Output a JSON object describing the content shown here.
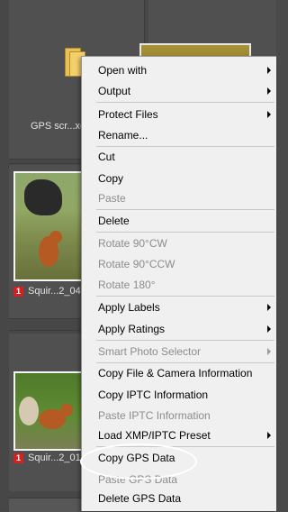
{
  "grid": {
    "folder_label": "GPS scr...xe",
    "photo1_label": "Squir...2_04",
    "photo2_label": "Squir...2_01",
    "rating_badge": "1",
    "badge_color": "#d62020"
  },
  "context_menu": {
    "items": [
      {
        "label": "Open with",
        "disabled": false,
        "submenu": true
      },
      {
        "label": "Output",
        "disabled": false,
        "submenu": true
      },
      {
        "label": "Protect Files",
        "disabled": false,
        "submenu": true
      },
      {
        "label": "Rename...",
        "disabled": false,
        "submenu": false
      },
      {
        "label": "Cut",
        "disabled": false,
        "submenu": false
      },
      {
        "label": "Copy",
        "disabled": false,
        "submenu": false
      },
      {
        "label": "Paste",
        "disabled": true,
        "submenu": false
      },
      {
        "label": "Delete",
        "disabled": false,
        "submenu": false
      },
      {
        "label": "Rotate 90°CW",
        "disabled": true,
        "submenu": false
      },
      {
        "label": "Rotate 90°CCW",
        "disabled": true,
        "submenu": false
      },
      {
        "label": "Rotate 180°",
        "disabled": true,
        "submenu": false
      },
      {
        "label": "Apply Labels",
        "disabled": false,
        "submenu": true
      },
      {
        "label": "Apply Ratings",
        "disabled": false,
        "submenu": true
      },
      {
        "label": "Smart Photo Selector",
        "disabled": true,
        "submenu": true
      },
      {
        "label": "Copy File & Camera Information",
        "disabled": false,
        "submenu": false
      },
      {
        "label": "Copy IPTC Information",
        "disabled": false,
        "submenu": false
      },
      {
        "label": "Paste IPTC Information",
        "disabled": true,
        "submenu": false
      },
      {
        "label": "Load XMP/IPTC Preset",
        "disabled": false,
        "submenu": true
      },
      {
        "label": "Copy GPS Data",
        "disabled": false,
        "submenu": false
      },
      {
        "label": "Paste GPS Data",
        "disabled": true,
        "submenu": false
      },
      {
        "label": "Delete GPS Data",
        "disabled": false,
        "submenu": false
      }
    ]
  }
}
